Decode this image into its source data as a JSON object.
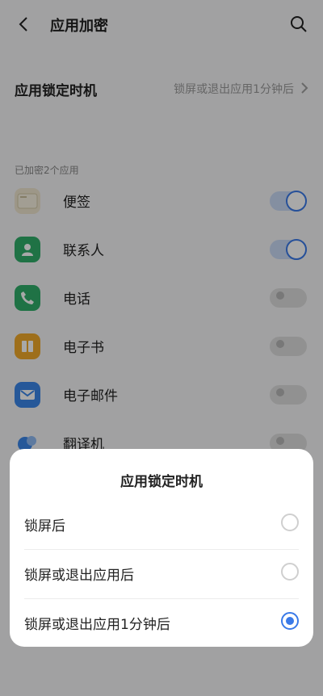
{
  "header": {
    "title": "应用加密"
  },
  "lock_timing": {
    "label": "应用锁定时机",
    "value": "锁屏或退出应用1分钟后"
  },
  "section": {
    "label": "已加密2个应用"
  },
  "apps": [
    {
      "name": "便签",
      "icon": "notes-icon",
      "enabled": true
    },
    {
      "name": "联系人",
      "icon": "contacts-icon",
      "enabled": true
    },
    {
      "name": "电话",
      "icon": "phone-icon",
      "enabled": false
    },
    {
      "name": "电子书",
      "icon": "ebook-icon",
      "enabled": false
    },
    {
      "name": "电子邮件",
      "icon": "email-icon",
      "enabled": false
    },
    {
      "name": "翻译机",
      "icon": "translator-icon",
      "enabled": false
    }
  ],
  "dialog": {
    "title": "应用锁定时机",
    "options": [
      {
        "label": "锁屏后",
        "selected": false
      },
      {
        "label": "锁屏或退出应用后",
        "selected": false
      },
      {
        "label": "锁屏或退出应用1分钟后",
        "selected": true
      }
    ]
  },
  "colors": {
    "accent": "#3a7ae8",
    "notes": "#efe6cf",
    "contacts": "#2fae6a",
    "phone": "#2fae6a",
    "ebook": "#f0a92a",
    "email": "#3b86e8"
  }
}
